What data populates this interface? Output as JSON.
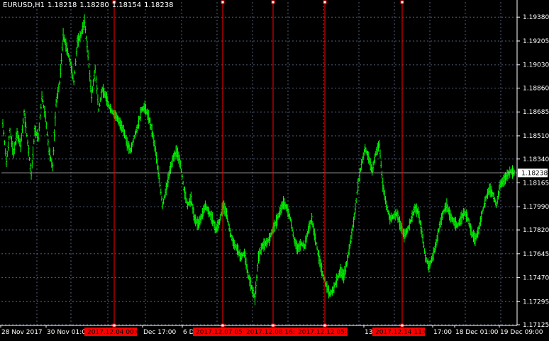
{
  "header": {
    "symbol": "EURUSD,H1",
    "open": "1.18218",
    "high": "1.18280",
    "low": "1.18154",
    "close": "1.18238"
  },
  "colors": {
    "background": "#000000",
    "bars": "#00ff00",
    "grid": "#55607a",
    "axis_text": "#ffffff",
    "vertical_lines": "#ff0000",
    "line_tag_bg": "#ff0000",
    "price_line": "#b4b4b4"
  },
  "chart_data": {
    "type": "ohlc-bars",
    "symbol": "EURUSD",
    "timeframe": "H1",
    "ylim": [
      1.1712,
      1.1949
    ],
    "grid": true,
    "y_ticks": [
      "1.19380",
      "1.19205",
      "1.19030",
      "1.18860",
      "1.18685",
      "1.18510",
      "1.18340",
      "1.18165",
      "1.17990",
      "1.17820",
      "1.17645",
      "1.17470",
      "1.17295",
      "1.17125"
    ],
    "current_price": "1.18238",
    "x_labels": [
      "28 Nov 2017",
      "30 Nov 01:00",
      "Dec 17:00",
      "6 De",
      "13",
      "17:00",
      "18 Dec 01:00",
      "19 Dec 09:00"
    ],
    "vertical_lines": [
      "2017.12.04 00:00",
      "2017.12.07 05:00",
      "2017.12.08 16:00",
      "2017.12.12 05:00",
      "2017.12.14 11:00"
    ],
    "price_path": [
      1.186,
      1.1832,
      1.1855,
      1.1838,
      1.1853,
      1.1844,
      1.1868,
      1.1846,
      1.1822,
      1.1855,
      1.185,
      1.188,
      1.1865,
      1.184,
      1.1828,
      1.1875,
      1.189,
      1.1925,
      1.1915,
      1.1905,
      1.189,
      1.192,
      1.1925,
      1.1935,
      1.191,
      1.188,
      1.19,
      1.187,
      1.1885,
      1.188,
      1.1872,
      1.1868,
      1.1865,
      1.186,
      1.1855,
      1.1845,
      1.184,
      1.185,
      1.1858,
      1.187,
      1.1872,
      1.1865,
      1.1855,
      1.184,
      1.182,
      1.18,
      1.1812,
      1.1825,
      1.1835,
      1.184,
      1.183,
      1.1812,
      1.18,
      1.1805,
      1.179,
      1.1786,
      1.1792,
      1.18,
      1.1795,
      1.179,
      1.1782,
      1.1788,
      1.18,
      1.1794,
      1.178,
      1.1772,
      1.1768,
      1.1762,
      1.1765,
      1.175,
      1.174,
      1.1732,
      1.1762,
      1.177,
      1.1772,
      1.1775,
      1.1782,
      1.1788,
      1.1795,
      1.1802,
      1.1798,
      1.179,
      1.1775,
      1.1768,
      1.1772,
      1.177,
      1.1782,
      1.179,
      1.1775,
      1.1762,
      1.175,
      1.1742,
      1.1735,
      1.1738,
      1.1745,
      1.1752,
      1.1748,
      1.176,
      1.1775,
      1.1792,
      1.1815,
      1.183,
      1.1842,
      1.1835,
      1.1825,
      1.1838,
      1.1845,
      1.1815,
      1.18,
      1.179,
      1.1792,
      1.1794,
      1.1785,
      1.1778,
      1.1782,
      1.179,
      1.1798,
      1.1795,
      1.178,
      1.1762,
      1.1755,
      1.1762,
      1.1772,
      1.1785,
      1.1795,
      1.18,
      1.1792,
      1.1788,
      1.1785,
      1.179,
      1.1795,
      1.179,
      1.178,
      1.1775,
      1.1782,
      1.1795,
      1.1805,
      1.1812,
      1.1808,
      1.18,
      1.1815,
      1.1818,
      1.1822,
      1.1825,
      1.1824
    ]
  }
}
